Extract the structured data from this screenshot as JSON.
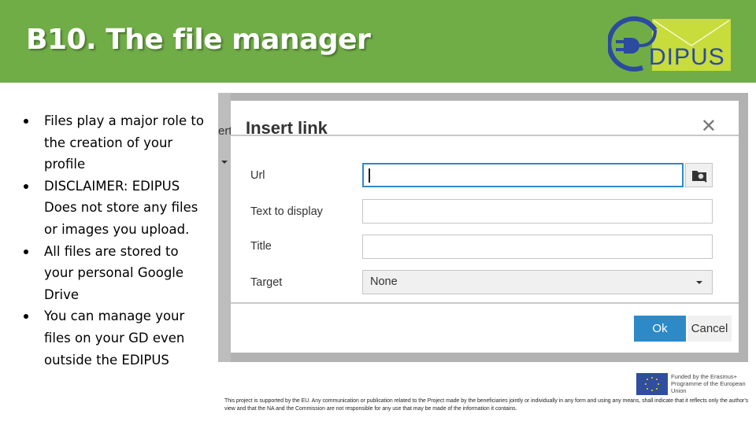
{
  "slide": {
    "title": "B10. The file manager",
    "colors": {
      "header_bg": "#70ad47",
      "logo_blue": "#2b4aa0",
      "logo_envelope": "#c8dc3c",
      "ok_button": "#2d8ac7"
    },
    "logo": {
      "text": "DIPUS",
      "icons": [
        "plug-icon",
        "envelope-icon"
      ]
    },
    "bullets": [
      "Files play a major role to the creation of your profile",
      "DISCLAIMER: EDIPUS Does not store any files or images you upload.",
      "All files are stored to your personal Google Drive",
      "You can manage your files on your GD even outside the EDIPUS"
    ]
  },
  "screenshot": {
    "background_fragment": "ert",
    "dialog": {
      "title": "Insert link",
      "close_icon": "close-icon",
      "fields": [
        {
          "label": "Url",
          "value": "",
          "focused": true,
          "browse_icon": "folder-search-icon"
        },
        {
          "label": "Text to display",
          "value": ""
        },
        {
          "label": "Title",
          "value": ""
        },
        {
          "label": "Target",
          "value": "None",
          "type": "select"
        }
      ],
      "buttons": {
        "ok": "Ok",
        "cancel": "Cancel"
      }
    }
  },
  "footer": {
    "eu_logo_text": "Funded by the Erasmus+ Programme of the European Union",
    "disclaimer": "This project is supported by the EU. Any communication or publication related to the Project made by the beneficiaries jointly or individually in any form and using any means, shall indicate that it reflects only the author's view and that the NA and the Commission are not responsible for any use that may be made of the information it contains."
  }
}
